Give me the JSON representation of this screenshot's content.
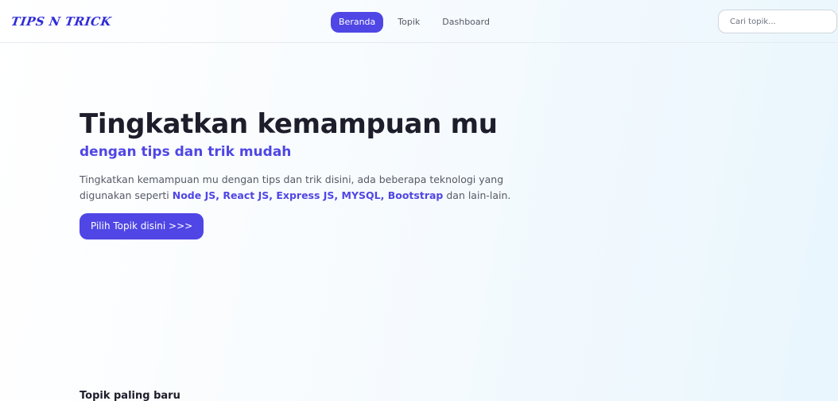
{
  "navbar": {
    "logo": "Tips n Trick",
    "links": [
      {
        "label": "Beranda",
        "active": true
      },
      {
        "label": "Topik",
        "active": false
      },
      {
        "label": "Dashboard",
        "active": false
      }
    ],
    "search_placeholder": "Cari topik..."
  },
  "hero": {
    "title": "Tingkatkan kemampuan mu",
    "subtitle": "dengan tips dan trik mudah",
    "desc_before": "Tingkatkan kemampuan mu dengan tips dan trik disini, ada beberapa teknologi yang digunakan seperti ",
    "desc_tech": "Node JS, React JS, Express JS, MYSQL, Bootstrap",
    "desc_after": " dan lain-lain.",
    "cta_label": "Pilih Topik disini >>>"
  },
  "latest": {
    "title": "Topik paling baru"
  },
  "colors": {
    "accent": "#4f46e5",
    "logo": "#2e2bd8",
    "text_dark": "#1d1d2b",
    "text_muted": "#555a66"
  }
}
